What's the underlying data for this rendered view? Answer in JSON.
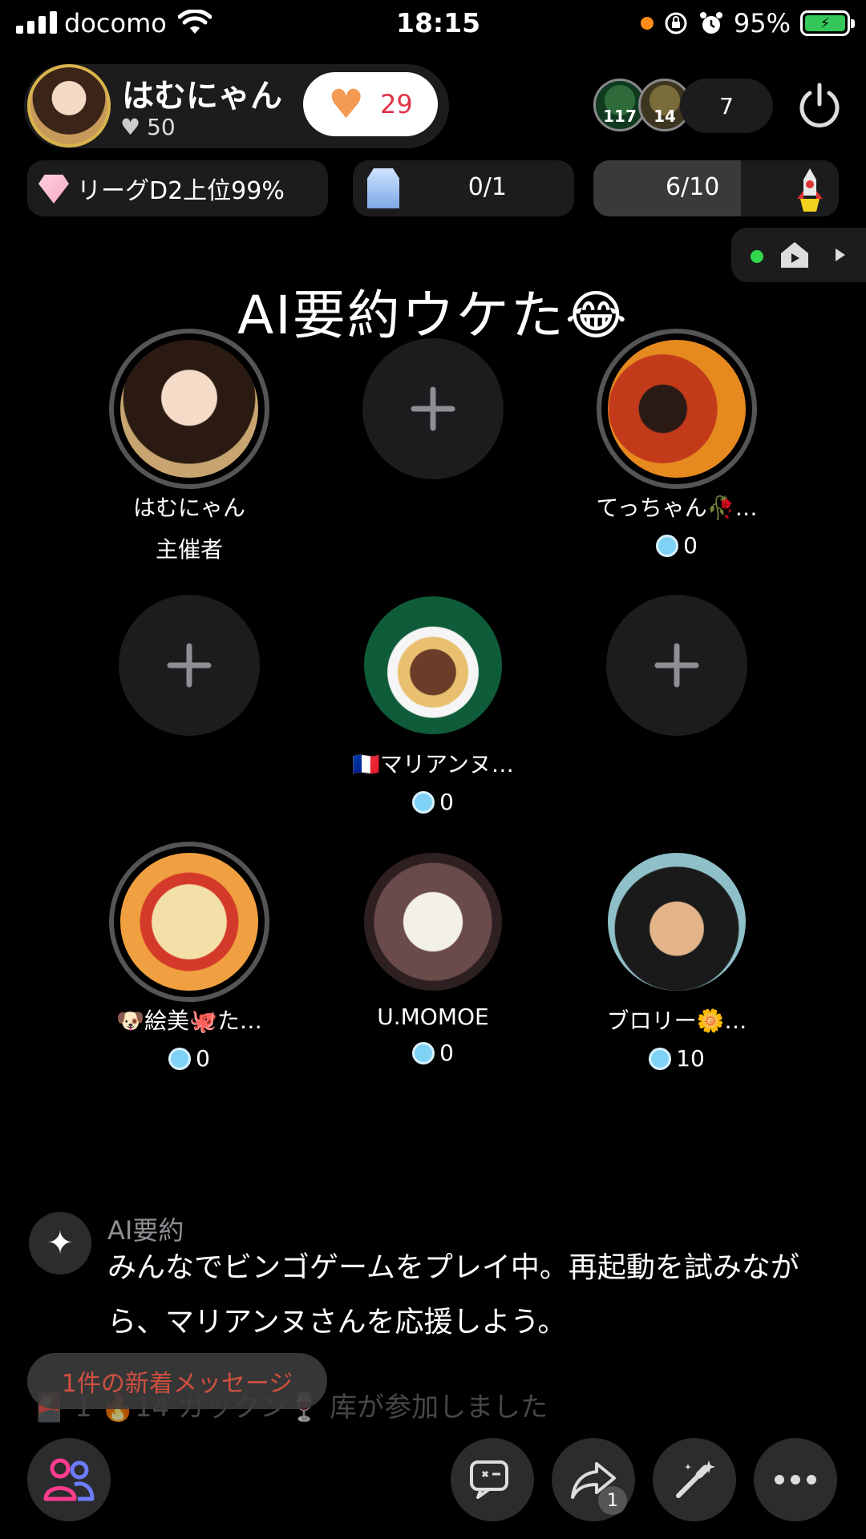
{
  "status_bar": {
    "carrier": "docomo",
    "time": "18:15",
    "battery_percent": "95%",
    "signal_bars": 4,
    "battery_color": "#34c759"
  },
  "host": {
    "name": "はむにゃん",
    "likes": "50",
    "heart_count": "29"
  },
  "badges": {
    "left": "117",
    "right": "14"
  },
  "viewer_count": "7",
  "stats": {
    "league": "リーグD2上位99%",
    "milk": "0/1",
    "progress_text": "6/10",
    "progress_fraction": 0.6
  },
  "room_title": "AI要約ウケた😂",
  "seats": [
    {
      "name": "はむにゃん",
      "sub": "主催者",
      "avatar": "host"
    },
    {
      "empty": true
    },
    {
      "name": "てっちゃん🥀…",
      "sub": "0",
      "avatar": "tecchan"
    },
    {
      "empty": true
    },
    {
      "name": "🇫🇷マリアンヌ…",
      "sub": "0",
      "avatar": "marianne"
    },
    {
      "empty": true
    },
    {
      "name": "🐶絵美🐙た…",
      "sub": "0",
      "avatar": "emi"
    },
    {
      "name": "U.MOMOE",
      "sub": "0",
      "avatar": "momoe"
    },
    {
      "name": "ブロリー🌼…",
      "sub": "10",
      "avatar": "broly"
    }
  ],
  "ai_summary": {
    "label": "AI要約",
    "text": "みんなでビンゴゲームをプレイ中。再起動を試みながら、マリアンヌさんを応援しよう。"
  },
  "chat": {
    "new_messages": "1件の新着メッセージ",
    "faded_line": "🎴 1 🔥14 ガックン🍷 库が参加しました"
  },
  "bottom_bar": {
    "share_badge": "1"
  },
  "colors": {
    "accent_pink": "#ff3b8d",
    "heart": "#f49a55",
    "heart_count": "#e0334a",
    "online_dot": "#32d74b"
  }
}
